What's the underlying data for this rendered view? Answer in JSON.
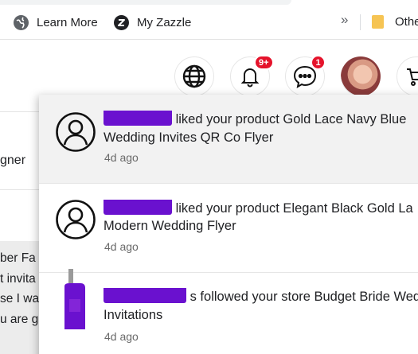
{
  "browser": {
    "bookmarks": [
      {
        "label": "Learn More",
        "icon": "globe-icon"
      },
      {
        "label": "My Zazzle",
        "icon": "zazzle-logo-icon"
      }
    ],
    "overflow": "»",
    "other_label": "Othe"
  },
  "header": {
    "icons": [
      "globe-icon",
      "bell-icon",
      "chat-icon",
      "avatar",
      "cart-icon"
    ],
    "bell_badge": "9+",
    "chat_badge": "1"
  },
  "left_page": {
    "sidebar_text": "gner",
    "card_lines": [
      "ber Fa",
      "t invita",
      "se I wa",
      "u are g"
    ]
  },
  "notifications": [
    {
      "actor": "redacted",
      "line1": "liked your product Gold Lace Navy Blue",
      "line2": "Wedding Invites QR Co Flyer",
      "time": "4d ago",
      "icon": "user-icon"
    },
    {
      "actor": "redacted",
      "line1": "liked your product Elegant Black Gold La",
      "line2": "Modern Wedding Flyer",
      "time": "4d ago",
      "icon": "user-icon"
    },
    {
      "actor": "redacted",
      "line1": "s followed your store Budget Bride Wed",
      "line2": "Invitations",
      "time": "4d ago",
      "icon": "product-thumbnail"
    }
  ],
  "colors": {
    "accent_badge": "#e5132b",
    "redaction": "#6a11cf",
    "selected_row_bg": "#f2f2f2"
  }
}
